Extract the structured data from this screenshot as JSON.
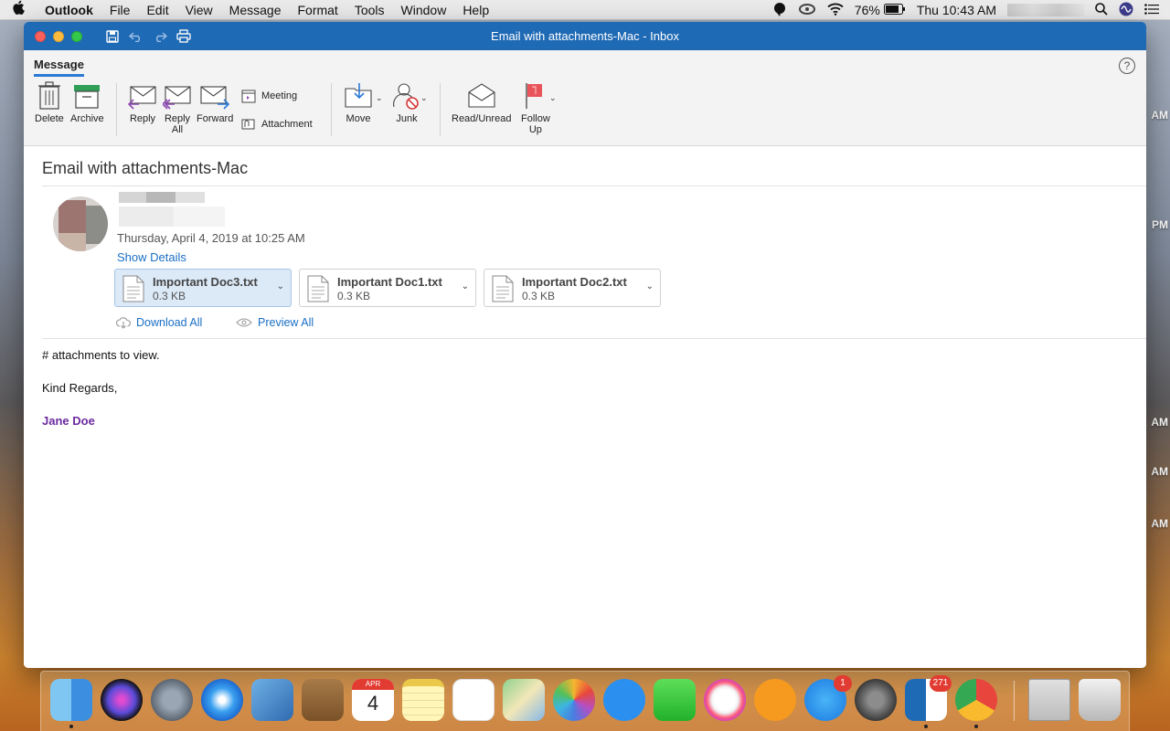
{
  "menubar": {
    "app": "Outlook",
    "items": [
      "File",
      "Edit",
      "View",
      "Message",
      "Format",
      "Tools",
      "Window",
      "Help"
    ],
    "battery": "76%",
    "clock": "Thu 10:43 AM"
  },
  "desktop_clock_fragments": [
    "AM",
    "PM",
    "AM",
    "AM",
    "AM"
  ],
  "window": {
    "title": "Email with attachments-Mac - Inbox"
  },
  "ribbon": {
    "tab": "Message",
    "buttons": {
      "delete": "Delete",
      "archive": "Archive",
      "reply": "Reply",
      "reply_all_1": "Reply",
      "reply_all_2": "All",
      "forward": "Forward",
      "meeting": "Meeting",
      "attachment": "Attachment",
      "move": "Move",
      "junk": "Junk",
      "read_unread": "Read/Unread",
      "follow_up_1": "Follow",
      "follow_up_2": "Up"
    }
  },
  "message": {
    "subject": "Email with attachments-Mac",
    "date": "Thursday, April 4, 2019 at 10:25 AM",
    "show_details": "Show Details",
    "attachments": [
      {
        "name": "Important Doc3.txt",
        "size": "0.3 KB",
        "selected": true
      },
      {
        "name": "Important Doc1.txt",
        "size": "0.3 KB",
        "selected": false
      },
      {
        "name": "Important Doc2.txt",
        "size": "0.3 KB",
        "selected": false
      }
    ],
    "download_all": "Download All",
    "preview_all": "Preview All",
    "body": [
      "# attachments to view.",
      "Kind Regards,"
    ],
    "signature": "Jane Doe"
  },
  "dock": {
    "calendar_month": "APR",
    "calendar_day": "4",
    "app_store_badge": "1",
    "outlook_badge": "271",
    "apps": [
      "finder",
      "siri",
      "launchpad",
      "safari",
      "mail",
      "contacts",
      "calendar",
      "notes",
      "reminders",
      "maps",
      "photos",
      "messages",
      "facetime",
      "itunes",
      "ibooks",
      "app-store",
      "system-preferences",
      "outlook",
      "chrome",
      "screenshot-preview",
      "trash"
    ]
  }
}
